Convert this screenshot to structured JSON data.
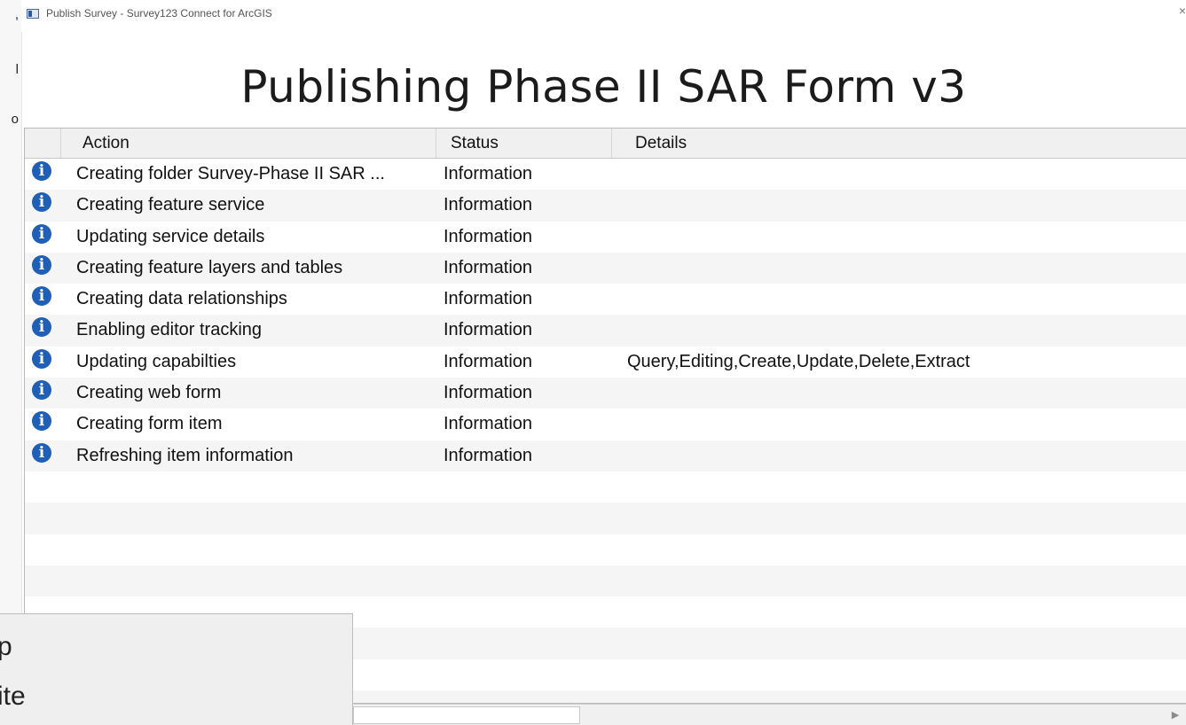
{
  "window": {
    "title": "Publish Survey - Survey123 Connect for ArcGIS",
    "close_glyph": "×"
  },
  "heading": "Publishing Phase II SAR Form v3",
  "background_fragments": [
    ",",
    "l",
    "o"
  ],
  "table": {
    "columns": [
      "Action",
      "Status",
      "Details"
    ],
    "rows": [
      {
        "icon": "info-icon",
        "action": "Creating folder Survey-Phase II SAR ...",
        "status": "Information",
        "details": ""
      },
      {
        "icon": "info-icon",
        "action": "Creating feature service",
        "status": "Information",
        "details": ""
      },
      {
        "icon": "info-icon",
        "action": "Updating service details",
        "status": "Information",
        "details": ""
      },
      {
        "icon": "info-icon",
        "action": "Creating feature layers and tables",
        "status": "Information",
        "details": ""
      },
      {
        "icon": "info-icon",
        "action": "Creating data relationships",
        "status": "Information",
        "details": ""
      },
      {
        "icon": "info-icon",
        "action": "Enabling editor tracking",
        "status": "Information",
        "details": ""
      },
      {
        "icon": "info-icon",
        "action": "Updating capabilties",
        "status": "Information",
        "details": "Query,Editing,Create,Update,Delete,Extract"
      },
      {
        "icon": "info-icon",
        "action": "Creating web form",
        "status": "Information",
        "details": ""
      },
      {
        "icon": "info-icon",
        "action": "Creating form item",
        "status": "Information",
        "details": ""
      },
      {
        "icon": "info-icon",
        "action": "Refreshing item information",
        "status": "Information",
        "details": ""
      }
    ],
    "empty_rows": 8
  },
  "popup": {
    "items": [
      "p",
      "ite"
    ]
  },
  "colors": {
    "info_icon": "#1f5fb5",
    "alt_row": "#f5f5f5",
    "header_bg": "#f0f0f0"
  }
}
